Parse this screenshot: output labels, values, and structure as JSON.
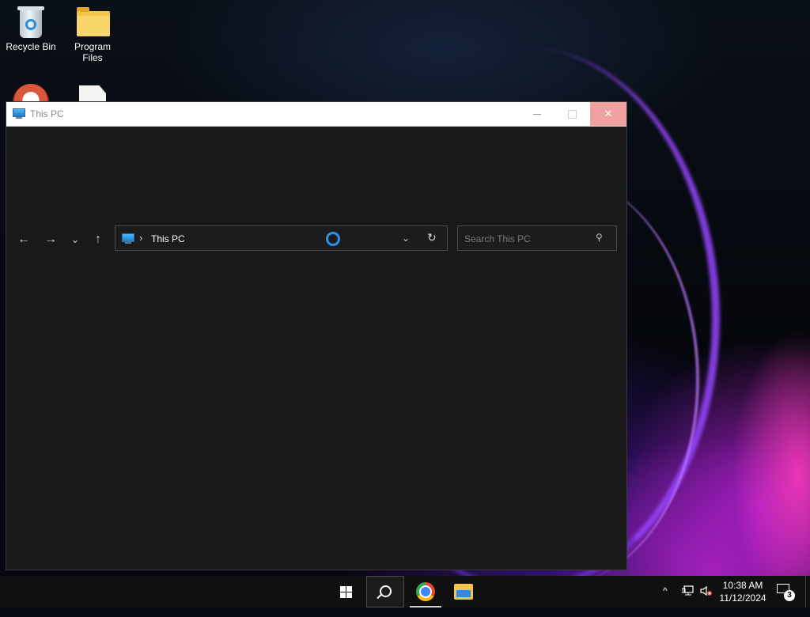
{
  "desktop": {
    "icons": [
      {
        "label": "Recycle Bin",
        "icon": "recycle-bin-icon"
      },
      {
        "label": "Program Files",
        "icon": "folder-icon"
      },
      {
        "label": "",
        "icon": "app-icon"
      },
      {
        "label": "",
        "icon": "document-icon"
      }
    ]
  },
  "window": {
    "title": "This PC",
    "controls": {
      "minimize": "minimize-icon",
      "maximize": "maximize-icon",
      "close": "close-icon"
    }
  },
  "navigation": {
    "back": "←",
    "forward": "→",
    "recent": "⌄",
    "up": "↑"
  },
  "address_bar": {
    "separator": "›",
    "crumb": "This PC",
    "dropdown": "⌄",
    "refresh": "↻"
  },
  "search": {
    "placeholder": "Search This PC",
    "glyph": "⚲"
  },
  "taskbar": {
    "apps": [
      "start",
      "search",
      "chrome",
      "file-explorer"
    ],
    "tray": {
      "overflow": "^",
      "time": "10:38 AM",
      "date": "11/12/2024",
      "notification_count": "3"
    }
  },
  "colors": {
    "window_bg": "#191919",
    "accent": "#2f8fe8",
    "close_hover": "#f1a1a1"
  }
}
